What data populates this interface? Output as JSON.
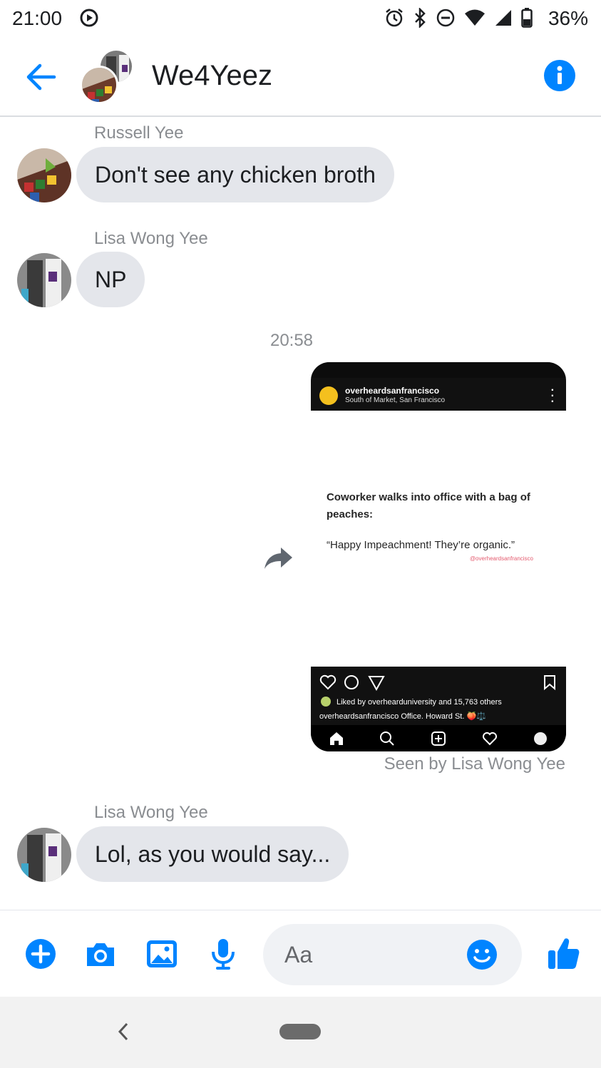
{
  "status_bar": {
    "time": "21:00",
    "battery": "36%"
  },
  "header": {
    "title": "We4Yeez"
  },
  "messages": [
    {
      "sender": "Russell Yee",
      "text": "Don't see any chicken broth"
    },
    {
      "sender": "Lisa Wong Yee",
      "text": "NP"
    },
    {
      "timestamp": "20:58"
    },
    {
      "shared_post": {
        "username": "overheardsanfrancisco",
        "location": "South of Market, San Francisco",
        "text_line1": "Coworker walks into office with a bag of peaches:",
        "text_line2": "“Happy Impeachment! They’re organic.”",
        "handle": "@overheardsanfrancisco",
        "liked_by": "Liked by overhearduniversity and 15,763 others",
        "caption": "overheardsanfrancisco Office. Howard St. 🍑⚖️"
      },
      "seen": "Seen by Lisa Wong Yee"
    },
    {
      "sender": "Lisa Wong Yee",
      "text": "Lol, as you would say..."
    }
  ],
  "composer": {
    "placeholder": "Aa"
  },
  "colors": {
    "accent": "#0084ff",
    "bubble": "#e4e6eb",
    "meta_text": "#8a8d91"
  }
}
